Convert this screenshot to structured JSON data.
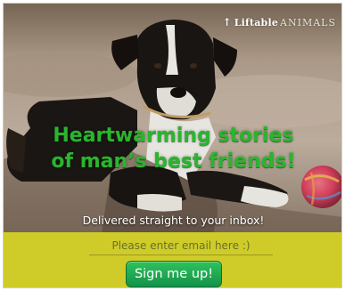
{
  "brand": {
    "name": "Liftable",
    "sub": "ANIMALS",
    "icon": "liftable-logo-icon"
  },
  "headline": {
    "line1": "Heartwarming stories",
    "line2": "of man’s best friends!"
  },
  "subline": "Delivered straight to your inbox!",
  "form": {
    "email_placeholder": "Please enter email here :)",
    "email_value": "",
    "submit_label": "Sign me up!"
  },
  "colors": {
    "headline_green": "#2bb52f",
    "form_background": "#cfcc2a",
    "button_green": "#1aa64e"
  }
}
